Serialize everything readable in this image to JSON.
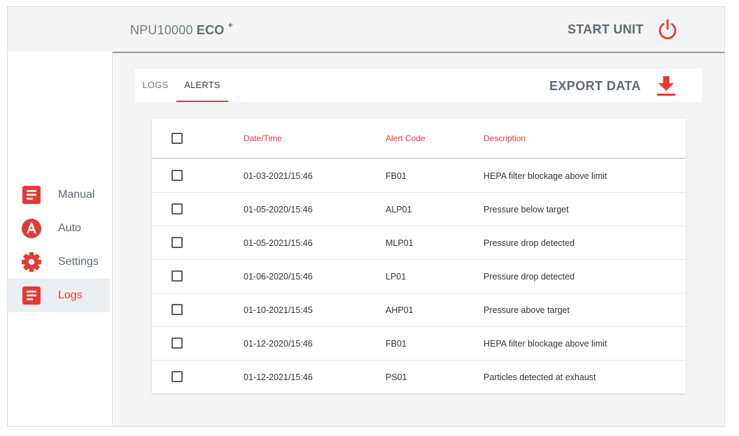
{
  "header": {
    "brand_model": "NPU10000",
    "brand_variant": "ECO",
    "brand_sup": "+",
    "start_label": "START UNIT"
  },
  "sidebar": {
    "items": [
      {
        "label": "Manual",
        "icon": "document-icon",
        "active": false
      },
      {
        "label": "Auto",
        "icon": "auto-a-icon",
        "active": false
      },
      {
        "label": "Settings",
        "icon": "gear-icon",
        "active": false
      },
      {
        "label": "Logs",
        "icon": "document-icon",
        "active": true
      }
    ]
  },
  "tabs": {
    "items": [
      {
        "label": "LOGS",
        "active": false
      },
      {
        "label": "ALERTS",
        "active": true
      }
    ],
    "export_label": "EXPORT DATA"
  },
  "table": {
    "headers": [
      "Date/Time",
      "Alert Code",
      "Description"
    ],
    "rows": [
      {
        "date": "01-03-2021/15:46",
        "code": "FB01",
        "desc": "HEPA filter blockage above limit",
        "checked": false
      },
      {
        "date": "01-05-2020/15:46",
        "code": "ALP01",
        "desc": "Pressure below target",
        "checked": false
      },
      {
        "date": "01-05-2021/15:46",
        "code": "MLP01",
        "desc": "Pressure drop detected",
        "checked": false
      },
      {
        "date": "01-06-2020/15:46",
        "code": "LP01",
        "desc": "Pressure drop detected",
        "checked": false
      },
      {
        "date": "01-10-2021/15:45",
        "code": "AHP01",
        "desc": "Pressure above target",
        "checked": false
      },
      {
        "date": "01-12-2020/15:46",
        "code": "FB01",
        "desc": "HEPA filter blockage above limit",
        "checked": false
      },
      {
        "date": "01-12-2021/15:46",
        "code": "PS01",
        "desc": "Particles detected at exhaust",
        "checked": false
      }
    ]
  },
  "colors": {
    "accent": "#e53935",
    "text_muted": "#5f6b74",
    "background": "#f4f4f4"
  }
}
